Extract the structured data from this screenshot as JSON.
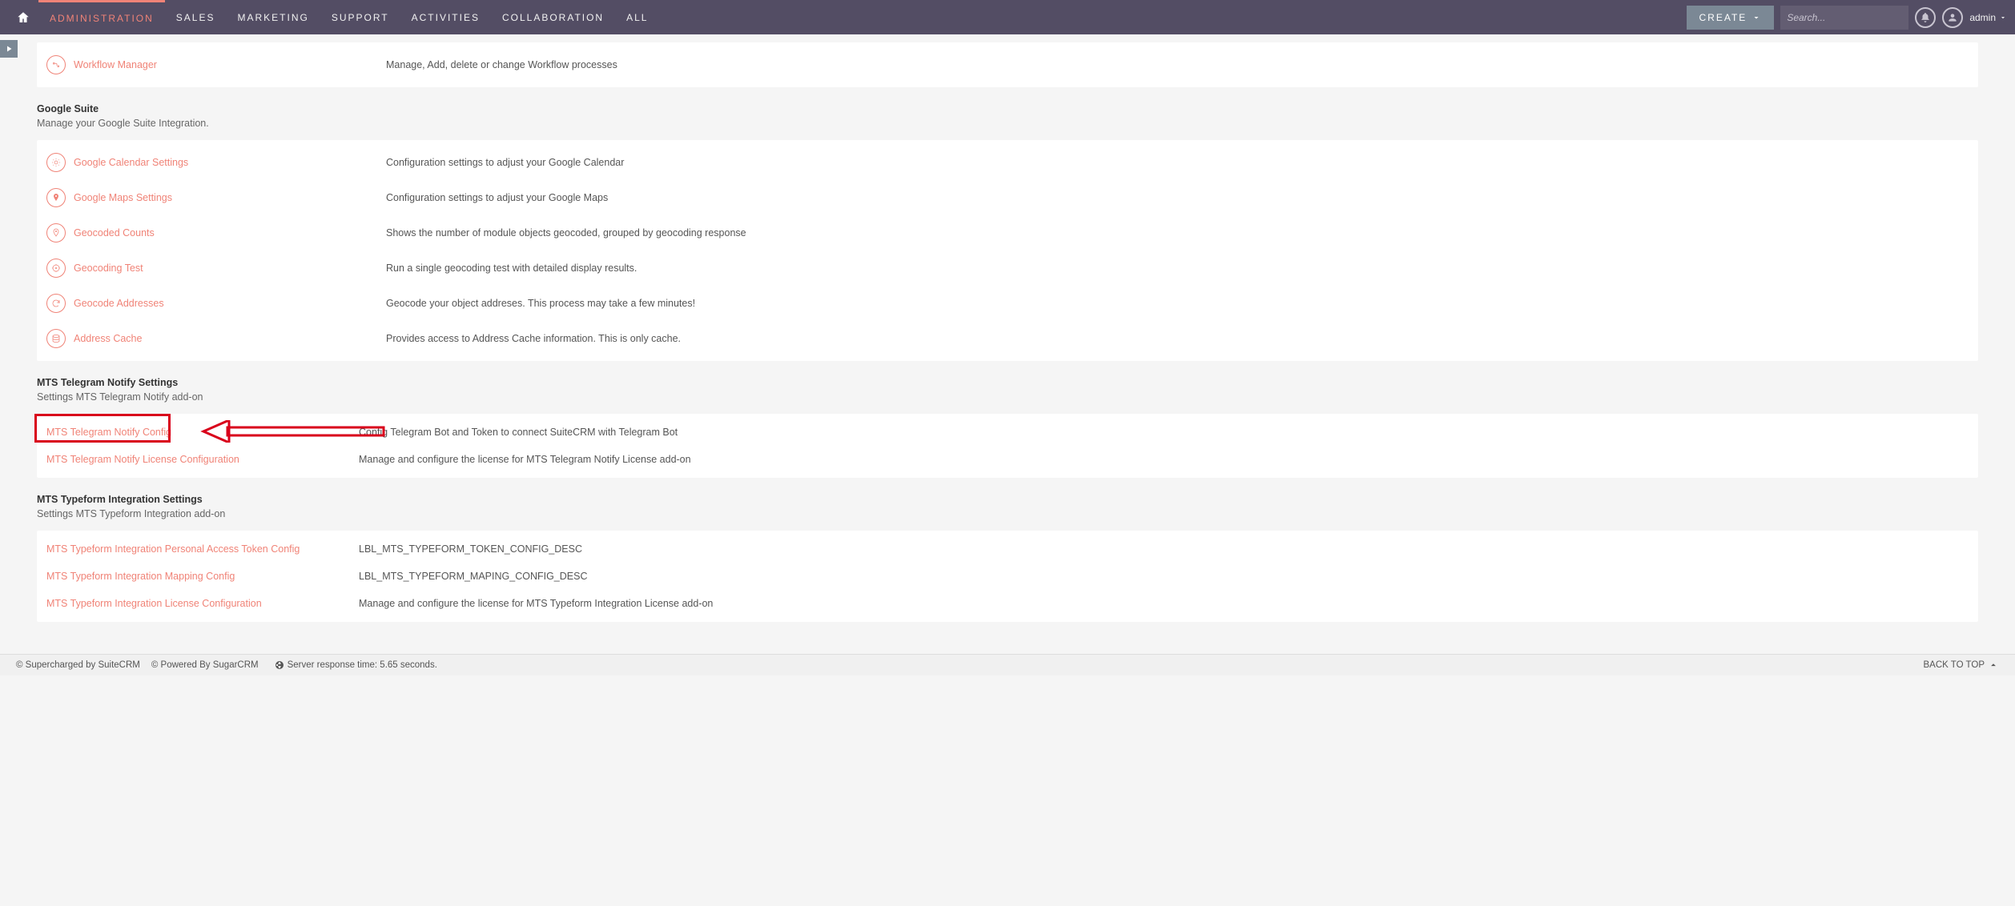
{
  "nav": {
    "items": [
      "ADMINISTRATION",
      "SALES",
      "MARKETING",
      "SUPPORT",
      "ACTIVITIES",
      "COLLABORATION",
      "ALL"
    ],
    "activeIndex": 0,
    "create": "CREATE",
    "search_placeholder": "Search...",
    "user": "admin"
  },
  "sections": [
    {
      "title": "",
      "subtitle": "",
      "rows": [
        {
          "icon": "workflow-icon",
          "label": "Workflow Manager",
          "desc": "Manage, Add, delete or change Workflow processes"
        }
      ]
    },
    {
      "title": "Google Suite",
      "subtitle": "Manage your Google Suite Integration.",
      "rows": [
        {
          "icon": "gear-icon",
          "label": "Google Calendar Settings",
          "desc": "Configuration settings to adjust your Google Calendar"
        },
        {
          "icon": "pin-icon",
          "label": "Google Maps Settings",
          "desc": "Configuration settings to adjust your Google Maps"
        },
        {
          "icon": "marker-icon",
          "label": "Geocoded Counts",
          "desc": "Shows the number of module objects geocoded, grouped by geocoding response"
        },
        {
          "icon": "target-icon",
          "label": "Geocoding Test",
          "desc": "Run a single geocoding test with detailed display results."
        },
        {
          "icon": "refresh-icon",
          "label": "Geocode Addresses",
          "desc": "Geocode your object addreses. This process may take a few minutes!"
        },
        {
          "icon": "cache-icon",
          "label": "Address Cache",
          "desc": "Provides access to Address Cache information. This is only cache."
        }
      ]
    },
    {
      "title": "MTS Telegram Notify Settings",
      "subtitle": "Settings MTS Telegram Notify add-on",
      "rows": [
        {
          "icon": "",
          "label": "MTS Telegram Notify Config",
          "desc": "Config Telegram Bot and Token to connect SuiteCRM with Telegram Bot",
          "highlight": true
        },
        {
          "icon": "",
          "label": "MTS Telegram Notify License Configuration",
          "desc": "Manage and configure the license for MTS Telegram Notify License add-on"
        }
      ]
    },
    {
      "title": "MTS Typeform Integration Settings",
      "subtitle": "Settings MTS Typeform Integration add-on",
      "rows": [
        {
          "icon": "",
          "label": "MTS Typeform Integration Personal Access Token Config",
          "desc": "LBL_MTS_TYPEFORM_TOKEN_CONFIG_DESC"
        },
        {
          "icon": "",
          "label": "MTS Typeform Integration Mapping Config",
          "desc": "LBL_MTS_TYPEFORM_MAPING_CONFIG_DESC"
        },
        {
          "icon": "",
          "label": "MTS Typeform Integration License Configuration",
          "desc": "Manage and configure the license for MTS Typeform Integration License add-on"
        }
      ]
    }
  ],
  "footer": {
    "supercharged": "© Supercharged by SuiteCRM",
    "powered": "© Powered By SugarCRM",
    "response": "Server response time: 5.65 seconds.",
    "backtotop": "BACK TO TOP"
  }
}
